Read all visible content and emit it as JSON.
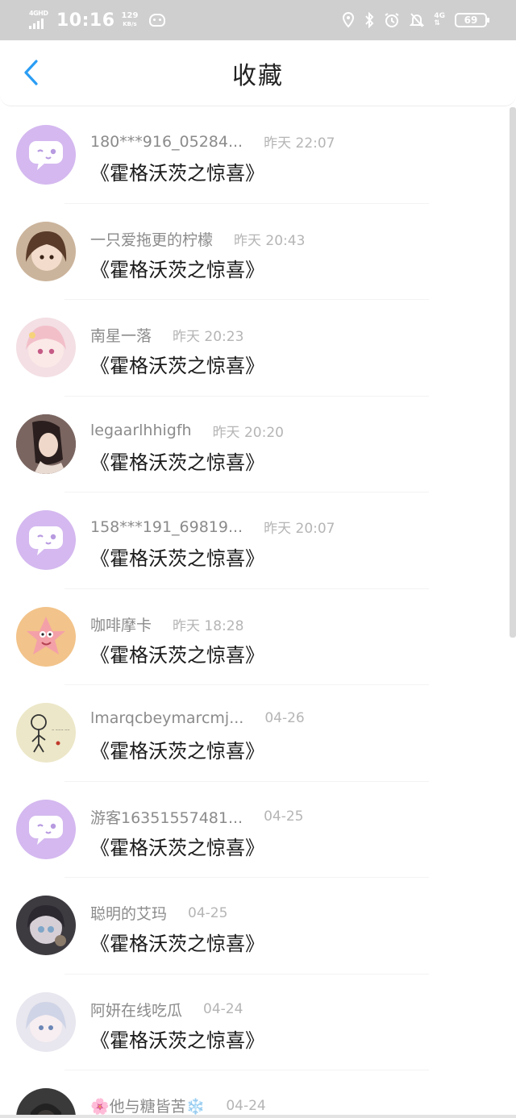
{
  "status": {
    "network": "4GHD",
    "time": "10:16",
    "speed_value": "129",
    "speed_unit": "KB/s",
    "cellular": "4G",
    "battery": "69",
    "icons": [
      "location-icon",
      "bluetooth-icon",
      "alarm-icon",
      "mute-bell-icon"
    ]
  },
  "header": {
    "title": "收藏"
  },
  "items": [
    {
      "name": "180***916_05284...",
      "time": "昨天 22:07",
      "book": "《霍格沃茨之惊喜》",
      "avatar": "chat-bubble",
      "bg": "#d4b8ef"
    },
    {
      "name": "一只爱拖更的柠檬",
      "time": "昨天 20:43",
      "book": "《霍格沃茨之惊喜》",
      "avatar": "anime-girl-brown",
      "bg": "#cbb49c"
    },
    {
      "name": "南星一落",
      "time": "昨天 20:23",
      "book": "《霍格沃茨之惊喜》",
      "avatar": "anime-girl-pink",
      "bg": "#f3dfe4"
    },
    {
      "name": "legaarlhhigfh",
      "time": "昨天 20:20",
      "book": "《霍格沃茨之惊喜》",
      "avatar": "photo-girl",
      "bg": "#6d5a55"
    },
    {
      "name": "158***191_69819...",
      "time": "昨天 20:07",
      "book": "《霍格沃茨之惊喜》",
      "avatar": "chat-bubble",
      "bg": "#d4b8ef"
    },
    {
      "name": "咖啡摩卡",
      "time": "昨天 18:28",
      "book": "《霍格沃茨之惊喜》",
      "avatar": "patrick-star",
      "bg": "#f2c38a"
    },
    {
      "name": "lmarqcbeymarcmj...",
      "time": "04-26",
      "book": "《霍格沃茨之惊喜》",
      "avatar": "sketch-figure",
      "bg": "#ece7c8"
    },
    {
      "name": "游客16351557481...",
      "time": "04-25",
      "book": "《霍格沃茨之惊喜》",
      "avatar": "chat-bubble",
      "bg": "#d4b8ef"
    },
    {
      "name": "聪明的艾玛",
      "time": "04-25",
      "book": "《霍格沃茨之惊喜》",
      "avatar": "anime-girl-hood",
      "bg": "#3d3a40"
    },
    {
      "name": "阿妍在线吃瓜",
      "time": "04-24",
      "book": "《霍格沃茨之惊喜》",
      "avatar": "anime-girl-pale",
      "bg": "#e8e6ee"
    },
    {
      "name": "🌸他与糖皆苦❄️",
      "time": "04-24",
      "book": "",
      "avatar": "photo-dark",
      "bg": "#3a3a3a"
    }
  ]
}
